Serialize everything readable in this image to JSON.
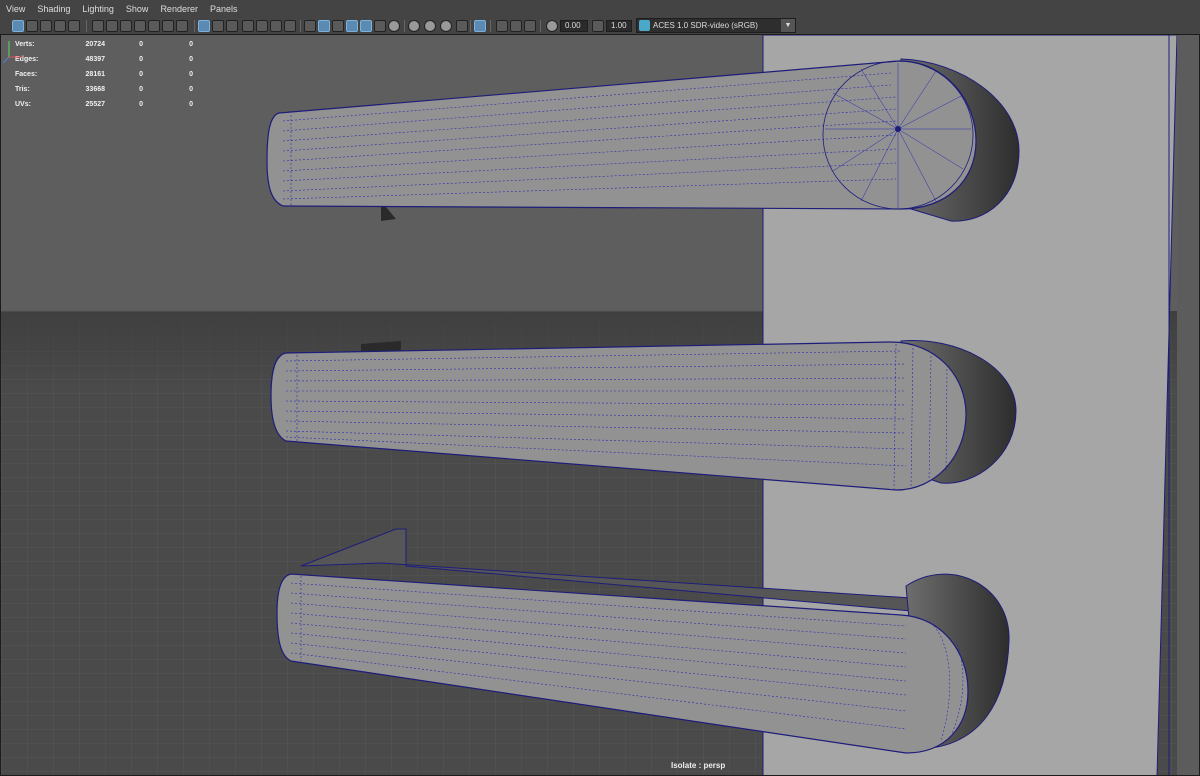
{
  "menu": [
    "View",
    "Shading",
    "Lighting",
    "Show",
    "Renderer",
    "Panels"
  ],
  "toolbar": {
    "exposure_value": "0.00",
    "gamma_value": "1.00",
    "colorspace": "ACES 1.0 SDR-video (sRGB)",
    "icons": [
      "select-camera-icon",
      "lock-camera-icon",
      "bookmark-icon",
      "image-plane-icon",
      "grid-icon",
      "film-gate-icon",
      "resolution-gate-icon",
      "safe-action-icon",
      "field-chart-icon",
      "wireframe-icon",
      "smooth-shade-icon",
      "wireframe-on-shaded-icon",
      "xray-icon",
      "lighting-icon",
      "shadows-icon",
      "ambient-occlusion-icon",
      "isolate-select-icon",
      "exposure-icon",
      "gamma-icon"
    ]
  },
  "hud": {
    "rows": [
      {
        "label": "Verts:",
        "v1": "20724",
        "v2": "0",
        "v3": "0"
      },
      {
        "label": "Edges:",
        "v1": "48397",
        "v2": "0",
        "v3": "0"
      },
      {
        "label": "Faces:",
        "v1": "28161",
        "v2": "0",
        "v3": "0"
      },
      {
        "label": "Tris:",
        "v1": "33668",
        "v2": "0",
        "v3": "0"
      },
      {
        "label": "UVs:",
        "v1": "25527",
        "v2": "0",
        "v3": "0"
      }
    ]
  },
  "viewport": {
    "status": "Isolate : persp",
    "camera": "persp",
    "wire_color": "#1d1d7a",
    "floor_color": "#4a4a4a",
    "wall_color": "#a6a6a6"
  }
}
